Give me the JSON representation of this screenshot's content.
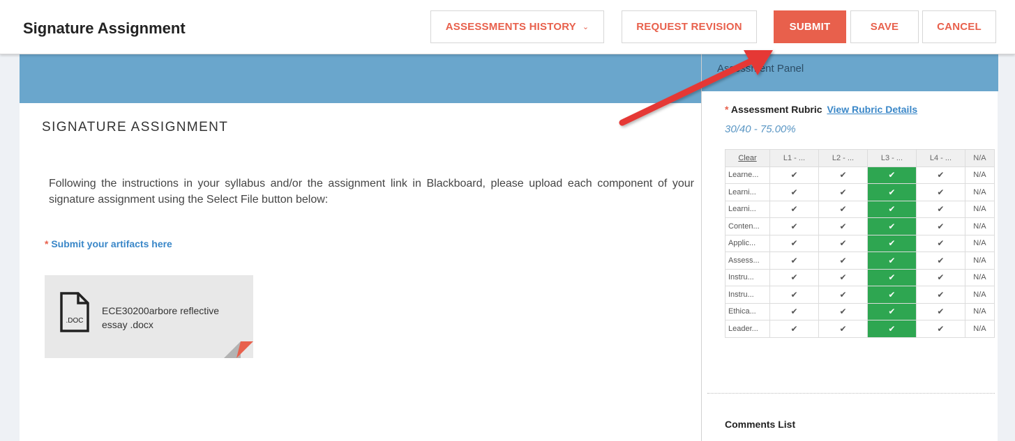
{
  "header": {
    "title": "Signature Assignment",
    "buttons": {
      "history": "ASSESSMENTS HISTORY",
      "revision": "REQUEST REVISION",
      "submit": "SUBMIT",
      "save": "SAVE",
      "cancel": "CANCEL"
    },
    "history_chevron": "⌄"
  },
  "main": {
    "section_title": "SIGNATURE ASSIGNMENT",
    "instructions": "Following the instructions in your syllabus and/or the assignment link in Blackboard, please upload each component of your signature assignment using the Select File button below:",
    "artifact_label": "Submit your artifacts here",
    "required_mark": "*",
    "file": {
      "name": "ECE30200arbore reflective essay .docx",
      "icon_text": ".DOC",
      "icon": "doc-file-icon"
    }
  },
  "panel": {
    "title": "Assessment Panel",
    "rubric_label": "Assessment Rubric",
    "rubric_link": "View Rubric Details",
    "score": "30/40 - 75.00%",
    "table": {
      "headers": [
        "Clear",
        "L1 - ...",
        "L2 - ...",
        "L3 - ...",
        "L4 - ...",
        "N/A"
      ],
      "rows": [
        "Learne...",
        "Learni...",
        "Learni...",
        "Conten...",
        "Applic...",
        "Assess...",
        "Instru...",
        "Instru...",
        "Ethica...",
        "Leader..."
      ],
      "check": "✔",
      "na": "N/A",
      "selected_level": "L3"
    },
    "comments_label": "Comments List"
  },
  "colors": {
    "accent": "#e8604c",
    "band": "#6aa6cc",
    "selected": "#2ea651",
    "link": "#3a87c8"
  }
}
